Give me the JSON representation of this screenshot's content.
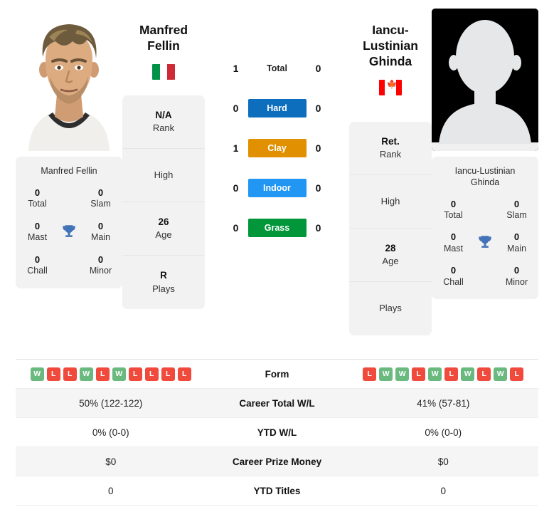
{
  "players": {
    "left": {
      "name_line1": "Manfred",
      "name_line2": "Fellin",
      "full_name": "Manfred Fellin",
      "country": "Italy",
      "flag_icon": "flag-italy-icon",
      "photo_type": "player-photo",
      "rank": "N/A",
      "rank_label": "Rank",
      "high_value": "",
      "high_label": "High",
      "age": "26",
      "age_label": "Age",
      "plays": "R",
      "plays_label": "Plays",
      "titles": {
        "total_val": "0",
        "total_lab": "Total",
        "slam_val": "0",
        "slam_lab": "Slam",
        "mast_val": "0",
        "mast_lab": "Mast",
        "main_val": "0",
        "main_lab": "Main",
        "chall_val": "0",
        "chall_lab": "Chall",
        "minor_val": "0",
        "minor_lab": "Minor"
      },
      "form": [
        "W",
        "L",
        "L",
        "W",
        "L",
        "W",
        "L",
        "L",
        "L",
        "L"
      ],
      "career_total_wl": "50% (122-122)",
      "ytd_wl": "0% (0-0)",
      "career_prize_money": "$0",
      "ytd_titles": "0"
    },
    "right": {
      "name_line1": "Iancu-Lustinian",
      "name_line2": "Ghinda",
      "full_name_line1": "Iancu-Lustinian",
      "full_name_line2": "Ghinda",
      "country": "Canada",
      "flag_icon": "flag-canada-icon",
      "photo_type": "avatar-placeholder",
      "rank": "Ret.",
      "rank_label": "Rank",
      "high_value": "",
      "high_label": "High",
      "age": "28",
      "age_label": "Age",
      "plays": "",
      "plays_label": "Plays",
      "titles": {
        "total_val": "0",
        "total_lab": "Total",
        "slam_val": "0",
        "slam_lab": "Slam",
        "mast_val": "0",
        "mast_lab": "Mast",
        "main_val": "0",
        "main_lab": "Main",
        "chall_val": "0",
        "chall_lab": "Chall",
        "minor_val": "0",
        "minor_lab": "Minor"
      },
      "form": [
        "L",
        "W",
        "W",
        "L",
        "W",
        "L",
        "W",
        "L",
        "W",
        "L"
      ],
      "career_total_wl": "41% (57-81)",
      "ytd_wl": "0% (0-0)",
      "career_prize_money": "$0",
      "ytd_titles": "0"
    }
  },
  "head_to_head": {
    "rows": [
      {
        "label": "Total",
        "left": "1",
        "right": "0",
        "style": "plain",
        "color": ""
      },
      {
        "label": "Hard",
        "left": "0",
        "right": "0",
        "style": "pill",
        "color": "#0d6ebd"
      },
      {
        "label": "Clay",
        "left": "1",
        "right": "0",
        "style": "pill",
        "color": "#e09000"
      },
      {
        "label": "Indoor",
        "left": "0",
        "right": "0",
        "style": "pill",
        "color": "#2196f3"
      },
      {
        "label": "Grass",
        "left": "0",
        "right": "0",
        "style": "pill",
        "color": "#009639"
      }
    ]
  },
  "comparison_table": {
    "rows": [
      {
        "label": "Form",
        "type": "form",
        "left": "",
        "right": ""
      },
      {
        "label": "Career Total W/L",
        "type": "text",
        "left": "50% (122-122)",
        "right": "41% (57-81)"
      },
      {
        "label": "YTD W/L",
        "type": "text",
        "left": "0% (0-0)",
        "right": "0% (0-0)"
      },
      {
        "label": "Career Prize Money",
        "type": "text",
        "left": "$0",
        "right": "$0"
      },
      {
        "label": "YTD Titles",
        "type": "text",
        "left": "0",
        "right": "0"
      }
    ]
  },
  "colors": {
    "hard": "#0d6ebd",
    "clay": "#e09000",
    "indoor": "#2196f3",
    "grass": "#009639",
    "win_badge": "#6ab97f",
    "loss_badge": "#ef4a3c",
    "card_bg": "#f2f2f2",
    "trophy": "#4273b8"
  }
}
